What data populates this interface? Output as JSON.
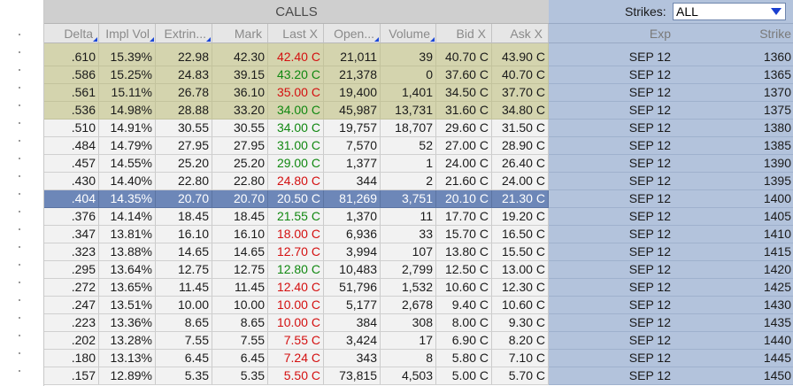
{
  "calls_title": "CALLS",
  "strikes_filter": {
    "label": "Strikes:",
    "value": "ALL"
  },
  "columns": {
    "delta": "Delta",
    "impl_vol": "Impl Vol",
    "extrinsic": "Extrin...",
    "mark": "Mark",
    "last": "Last X",
    "open_int": "Open...",
    "volume": "Volume",
    "bid": "Bid X",
    "ask": "Ask X",
    "exp": "Exp",
    "strike": "Strike"
  },
  "rows": [
    {
      "delta": ".610",
      "impl_vol": "15.39%",
      "extrinsic": "22.98",
      "mark": "42.30",
      "last": "42.40",
      "last_ex": "C",
      "last_dir": "down",
      "open_int": "21,011",
      "volume": "39",
      "bid": "40.70",
      "bid_ex": "C",
      "ask": "43.90",
      "ask_ex": "C",
      "exp": "SEP 12",
      "strike": "1360",
      "state": "itm"
    },
    {
      "delta": ".586",
      "impl_vol": "15.25%",
      "extrinsic": "24.83",
      "mark": "39.15",
      "last": "43.20",
      "last_ex": "C",
      "last_dir": "up",
      "open_int": "21,378",
      "volume": "0",
      "bid": "37.60",
      "bid_ex": "C",
      "ask": "40.70",
      "ask_ex": "C",
      "exp": "SEP 12",
      "strike": "1365",
      "state": "itm"
    },
    {
      "delta": ".561",
      "impl_vol": "15.11%",
      "extrinsic": "26.78",
      "mark": "36.10",
      "last": "35.00",
      "last_ex": "C",
      "last_dir": "down",
      "open_int": "19,400",
      "volume": "1,401",
      "bid": "34.50",
      "bid_ex": "C",
      "ask": "37.70",
      "ask_ex": "C",
      "exp": "SEP 12",
      "strike": "1370",
      "state": "itm"
    },
    {
      "delta": ".536",
      "impl_vol": "14.98%",
      "extrinsic": "28.88",
      "mark": "33.20",
      "last": "34.00",
      "last_ex": "C",
      "last_dir": "up",
      "open_int": "45,987",
      "volume": "13,731",
      "bid": "31.60",
      "bid_ex": "C",
      "ask": "34.80",
      "ask_ex": "C",
      "exp": "SEP 12",
      "strike": "1375",
      "state": "itm"
    },
    {
      "delta": ".510",
      "impl_vol": "14.91%",
      "extrinsic": "30.55",
      "mark": "30.55",
      "last": "34.00",
      "last_ex": "C",
      "last_dir": "up",
      "open_int": "19,757",
      "volume": "18,707",
      "bid": "29.60",
      "bid_ex": "C",
      "ask": "31.50",
      "ask_ex": "C",
      "exp": "SEP 12",
      "strike": "1380",
      "state": "otm"
    },
    {
      "delta": ".484",
      "impl_vol": "14.79%",
      "extrinsic": "27.95",
      "mark": "27.95",
      "last": "31.00",
      "last_ex": "C",
      "last_dir": "up",
      "open_int": "7,570",
      "volume": "52",
      "bid": "27.00",
      "bid_ex": "C",
      "ask": "28.90",
      "ask_ex": "C",
      "exp": "SEP 12",
      "strike": "1385",
      "state": "otm"
    },
    {
      "delta": ".457",
      "impl_vol": "14.55%",
      "extrinsic": "25.20",
      "mark": "25.20",
      "last": "29.00",
      "last_ex": "C",
      "last_dir": "up",
      "open_int": "1,377",
      "volume": "1",
      "bid": "24.00",
      "bid_ex": "C",
      "ask": "26.40",
      "ask_ex": "C",
      "exp": "SEP 12",
      "strike": "1390",
      "state": "otm"
    },
    {
      "delta": ".430",
      "impl_vol": "14.40%",
      "extrinsic": "22.80",
      "mark": "22.80",
      "last": "24.80",
      "last_ex": "C",
      "last_dir": "down",
      "open_int": "344",
      "volume": "2",
      "bid": "21.60",
      "bid_ex": "C",
      "ask": "24.00",
      "ask_ex": "C",
      "exp": "SEP 12",
      "strike": "1395",
      "state": "otm"
    },
    {
      "delta": ".404",
      "impl_vol": "14.35%",
      "extrinsic": "20.70",
      "mark": "20.70",
      "last": "20.50",
      "last_ex": "C",
      "last_dir": "down",
      "open_int": "81,269",
      "volume": "3,751",
      "bid": "20.10",
      "bid_ex": "C",
      "ask": "21.30",
      "ask_ex": "C",
      "exp": "SEP 12",
      "strike": "1400",
      "state": "sel"
    },
    {
      "delta": ".376",
      "impl_vol": "14.14%",
      "extrinsic": "18.45",
      "mark": "18.45",
      "last": "21.55",
      "last_ex": "C",
      "last_dir": "up",
      "open_int": "1,370",
      "volume": "11",
      "bid": "17.70",
      "bid_ex": "C",
      "ask": "19.20",
      "ask_ex": "C",
      "exp": "SEP 12",
      "strike": "1405",
      "state": "otm"
    },
    {
      "delta": ".347",
      "impl_vol": "13.81%",
      "extrinsic": "16.10",
      "mark": "16.10",
      "last": "18.00",
      "last_ex": "C",
      "last_dir": "down",
      "open_int": "6,936",
      "volume": "33",
      "bid": "15.70",
      "bid_ex": "C",
      "ask": "16.50",
      "ask_ex": "C",
      "exp": "SEP 12",
      "strike": "1410",
      "state": "otm"
    },
    {
      "delta": ".323",
      "impl_vol": "13.88%",
      "extrinsic": "14.65",
      "mark": "14.65",
      "last": "12.70",
      "last_ex": "C",
      "last_dir": "down",
      "open_int": "3,994",
      "volume": "107",
      "bid": "13.80",
      "bid_ex": "C",
      "ask": "15.50",
      "ask_ex": "C",
      "exp": "SEP 12",
      "strike": "1415",
      "state": "otm"
    },
    {
      "delta": ".295",
      "impl_vol": "13.64%",
      "extrinsic": "12.75",
      "mark": "12.75",
      "last": "12.80",
      "last_ex": "C",
      "last_dir": "up",
      "open_int": "10,483",
      "volume": "2,799",
      "bid": "12.50",
      "bid_ex": "C",
      "ask": "13.00",
      "ask_ex": "C",
      "exp": "SEP 12",
      "strike": "1420",
      "state": "otm"
    },
    {
      "delta": ".272",
      "impl_vol": "13.65%",
      "extrinsic": "11.45",
      "mark": "11.45",
      "last": "12.40",
      "last_ex": "C",
      "last_dir": "down",
      "open_int": "51,796",
      "volume": "1,532",
      "bid": "10.60",
      "bid_ex": "C",
      "ask": "12.30",
      "ask_ex": "C",
      "exp": "SEP 12",
      "strike": "1425",
      "state": "otm"
    },
    {
      "delta": ".247",
      "impl_vol": "13.51%",
      "extrinsic": "10.00",
      "mark": "10.00",
      "last": "10.00",
      "last_ex": "C",
      "last_dir": "down",
      "open_int": "5,177",
      "volume": "2,678",
      "bid": "9.40",
      "bid_ex": "C",
      "ask": "10.60",
      "ask_ex": "C",
      "exp": "SEP 12",
      "strike": "1430",
      "state": "otm"
    },
    {
      "delta": ".223",
      "impl_vol": "13.36%",
      "extrinsic": "8.65",
      "mark": "8.65",
      "last": "10.00",
      "last_ex": "C",
      "last_dir": "down",
      "open_int": "384",
      "volume": "308",
      "bid": "8.00",
      "bid_ex": "C",
      "ask": "9.30",
      "ask_ex": "C",
      "exp": "SEP 12",
      "strike": "1435",
      "state": "otm"
    },
    {
      "delta": ".202",
      "impl_vol": "13.28%",
      "extrinsic": "7.55",
      "mark": "7.55",
      "last": "7.55",
      "last_ex": "C",
      "last_dir": "down",
      "open_int": "3,424",
      "volume": "17",
      "bid": "6.90",
      "bid_ex": "C",
      "ask": "8.20",
      "ask_ex": "C",
      "exp": "SEP 12",
      "strike": "1440",
      "state": "otm"
    },
    {
      "delta": ".180",
      "impl_vol": "13.13%",
      "extrinsic": "6.45",
      "mark": "6.45",
      "last": "7.24",
      "last_ex": "C",
      "last_dir": "down",
      "open_int": "343",
      "volume": "8",
      "bid": "5.80",
      "bid_ex": "C",
      "ask": "7.10",
      "ask_ex": "C",
      "exp": "SEP 12",
      "strike": "1445",
      "state": "otm"
    },
    {
      "delta": ".157",
      "impl_vol": "12.89%",
      "extrinsic": "5.35",
      "mark": "5.35",
      "last": "5.50",
      "last_ex": "C",
      "last_dir": "down",
      "open_int": "73,815",
      "volume": "4,503",
      "bid": "5.00",
      "bid_ex": "C",
      "ask": "5.70",
      "ask_ex": "C",
      "exp": "SEP 12",
      "strike": "1450",
      "state": "otm"
    }
  ],
  "colors": {
    "itm_background": "#d4d4ae",
    "selected_row": "#6d87b8",
    "strike_panel": "#b3c3dc",
    "price_up": "#118811",
    "price_down": "#d41010"
  }
}
